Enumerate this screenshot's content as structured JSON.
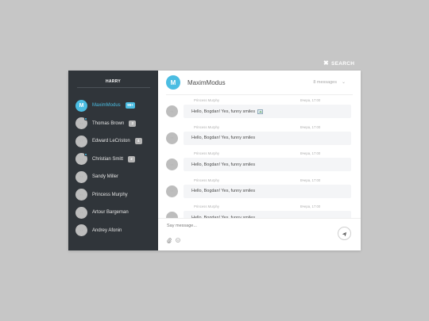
{
  "search": {
    "label": "SEARCH",
    "icon": "close-icon"
  },
  "sidebar": {
    "title": "HARRY",
    "contacts": [
      {
        "name": "MaximModus",
        "initial": "M",
        "badge": "99+",
        "active": true,
        "online": false
      },
      {
        "name": "Thomas Brown",
        "badge": "2",
        "active": false,
        "online": true
      },
      {
        "name": "Edward LeCriston",
        "badge": "4",
        "active": false,
        "online": false
      },
      {
        "name": "Christian Smitt",
        "badge": "2",
        "active": false,
        "online": true
      },
      {
        "name": "Sandy Miller",
        "badge": "",
        "active": false,
        "online": false
      },
      {
        "name": "Princess Murphy",
        "badge": "",
        "active": false,
        "online": false
      },
      {
        "name": "Artour Bargeman",
        "badge": "",
        "active": false,
        "online": false
      },
      {
        "name": "Andrey Afonin",
        "badge": "",
        "active": false,
        "online": false
      }
    ]
  },
  "chat": {
    "header_initial": "M",
    "header_name": "MaximModus",
    "message_count": "8 messages",
    "messages": [
      {
        "author": "Princess Murphy",
        "time": "Вчера, 17:00",
        "text": "Hello, Bogdan! Yes, funny smiles",
        "has_image": true
      },
      {
        "author": "Princess Murphy",
        "time": "Вчера, 17:00",
        "text": "Hello, Bogdan! Yes, funny smiles",
        "has_image": false
      },
      {
        "author": "Princess Murphy",
        "time": "Вчера, 17:00",
        "text": "Hello, Bogdan! Yes, funny smiles",
        "has_image": false
      },
      {
        "author": "Princess Murphy",
        "time": "Вчера, 17:00",
        "text": "Hello, Bogdan! Yes, funny smiles",
        "has_image": false
      },
      {
        "author": "Princess Murphy",
        "time": "Вчера, 17:00",
        "text": "Hello, Bogdan! Yes, funny smiles",
        "has_image": false
      }
    ],
    "composer_placeholder": "Say message...",
    "composer_tools": [
      "paperclip-icon",
      "smiley-icon"
    ],
    "send_icon": "send-icon"
  },
  "colors": {
    "accent": "#4bbde2",
    "sidebar_bg": "#30353a",
    "page_bg": "#c6c6c6"
  }
}
